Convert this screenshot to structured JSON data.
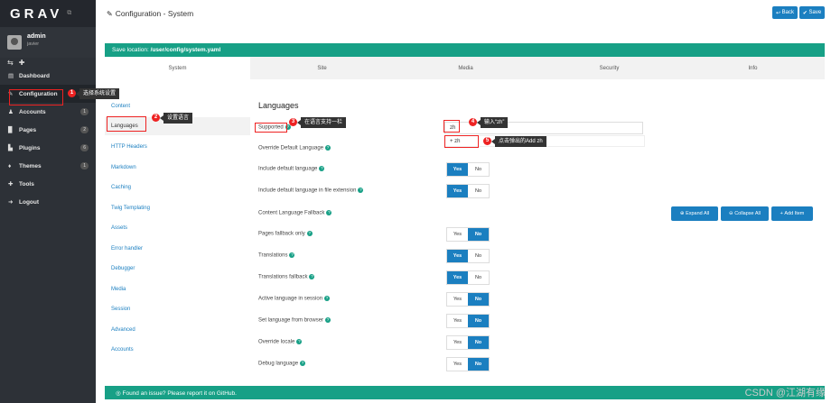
{
  "sidebar": {
    "logo": "GRAV",
    "user": {
      "name": "admin",
      "role": "javier"
    },
    "items": [
      {
        "icon": "▤",
        "label": "Dashboard",
        "badge": ""
      },
      {
        "icon": "✎",
        "label": "Configuration",
        "badge": ""
      },
      {
        "icon": "♟",
        "label": "Accounts",
        "badge": "1"
      },
      {
        "icon": "▉",
        "label": "Pages",
        "badge": "2"
      },
      {
        "icon": "▙",
        "label": "Plugins",
        "badge": "6"
      },
      {
        "icon": "♦",
        "label": "Themes",
        "badge": "1"
      },
      {
        "icon": "✚",
        "label": "Tools",
        "badge": ""
      },
      {
        "icon": "➜",
        "label": "Logout",
        "badge": ""
      }
    ]
  },
  "header": {
    "title": "Configuration - System",
    "back_label": "Back",
    "save_label": "Save"
  },
  "save_location": {
    "prefix": "Save location:",
    "path": "/user/config/system.yaml"
  },
  "tabs": [
    "System",
    "Site",
    "Media",
    "Security",
    "Info"
  ],
  "sections": [
    "Content",
    "Languages",
    "HTTP Headers",
    "Markdown",
    "Caching",
    "Twig Templating",
    "Assets",
    "Error handler",
    "Debugger",
    "Media",
    "Session",
    "Advanced",
    "Accounts"
  ],
  "form": {
    "title": "Languages",
    "supported_label": "Supported",
    "supported_value": "zh",
    "suggestion_value": "+ zh",
    "override_label": "Override Default Language",
    "fields": [
      {
        "label": "Include default language",
        "yes": "Yes",
        "no": "No",
        "value": "yes"
      },
      {
        "label": "Include default language in file extension",
        "yes": "Yes",
        "no": "No",
        "value": "yes"
      },
      {
        "label": "Pages fallback only",
        "yes": "Yes",
        "no": "No",
        "value": "no"
      },
      {
        "label": "Translations",
        "yes": "Yes",
        "no": "No",
        "value": "yes"
      },
      {
        "label": "Translations fallback",
        "yes": "Yes",
        "no": "No",
        "value": "yes"
      },
      {
        "label": "Active language in session",
        "yes": "Yes",
        "no": "No",
        "value": "no"
      },
      {
        "label": "Set language from browser",
        "yes": "Yes",
        "no": "No",
        "value": "no"
      },
      {
        "label": "Override locale",
        "yes": "Yes",
        "no": "No",
        "value": "no"
      },
      {
        "label": "Debug language",
        "yes": "Yes",
        "no": "No",
        "value": "no"
      }
    ],
    "fallback_label": "Content Language Fallback",
    "expand_all": "Expand All",
    "collapse_all": "Collapse All",
    "add_item": "Add Item"
  },
  "footer": {
    "text": "Found an issue? Please report it on GitHub."
  },
  "annotations": [
    {
      "num": "1",
      "text": "选择系统设置"
    },
    {
      "num": "2",
      "text": "设置语言"
    },
    {
      "num": "3",
      "text": "在语言支持一栏"
    },
    {
      "num": "4",
      "text": "输入“zh”"
    },
    {
      "num": "5",
      "text": "点击弹出的Add zh"
    }
  ],
  "watermark": "CSDN @江湖有缘",
  "colors": {
    "sidebar": "#2d3137",
    "accent": "#1b7fc0",
    "teal": "#17a086",
    "annotation": "#e22222"
  }
}
